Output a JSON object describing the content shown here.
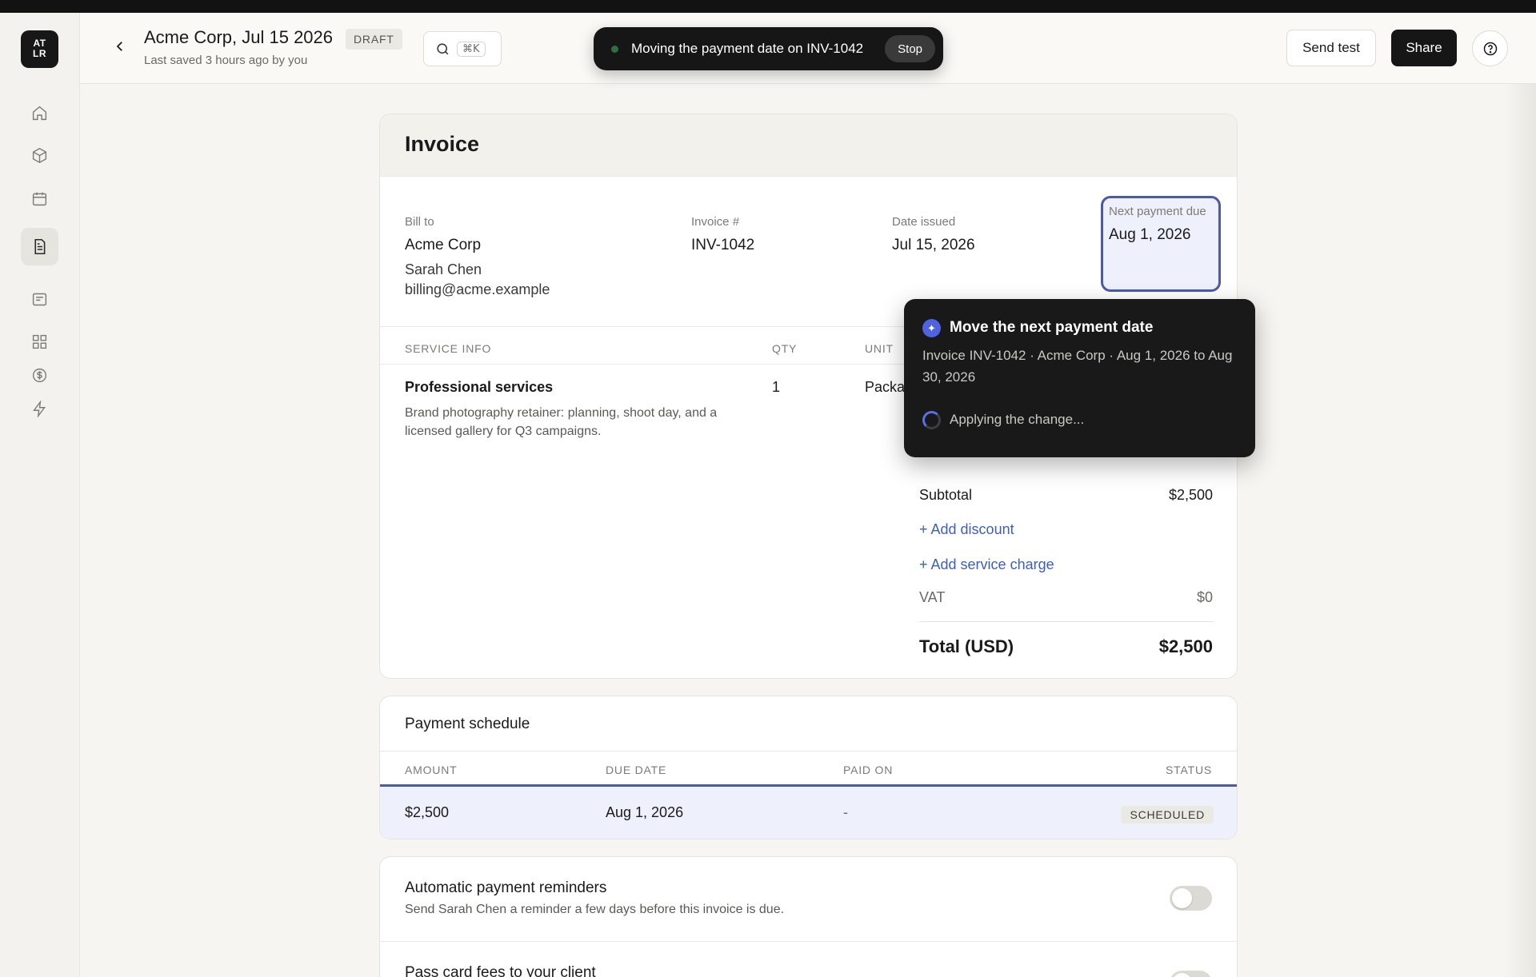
{
  "sidebar": {
    "logo_text": "AT LR",
    "items": [
      {
        "name": "home",
        "icon": "home-icon"
      },
      {
        "name": "packages",
        "icon": "box-icon"
      },
      {
        "name": "calendar",
        "icon": "calendar-icon"
      },
      {
        "name": "invoices",
        "icon": "document-icon",
        "active": true
      },
      {
        "name": "forms",
        "icon": "form-icon"
      },
      {
        "name": "apps",
        "icon": "grid-icon"
      },
      {
        "name": "payments",
        "icon": "dollar-icon"
      },
      {
        "name": "automations",
        "icon": "lightning-icon"
      }
    ]
  },
  "header": {
    "title": "Acme Corp, Jul 15 2026",
    "badge": "DRAFT",
    "saved": "Last saved 3 hours ago by you",
    "search_shortcut": "⌘K",
    "agent_status": "Moving the payment date on INV-1042",
    "stop_label": "Stop",
    "send_test_label": "Send test",
    "share_label": "Share"
  },
  "invoice": {
    "heading": "Invoice",
    "bill_to_label": "Bill to",
    "bill_to_company": "Acme Corp",
    "bill_to_contact": "Sarah Chen",
    "bill_to_email": "billing@acme.example",
    "invoice_no_label": "Invoice #",
    "invoice_no": "INV-1042",
    "date_issued_label": "Date issued",
    "date_issued": "Jul 15, 2026",
    "next_due_label": "Next payment due",
    "next_due": "Aug 1, 2026",
    "columns": {
      "service": "SERVICE INFO",
      "qty": "QTY",
      "unit": "UNIT"
    },
    "line_item": {
      "title": "Professional services",
      "description": "Brand photography retainer: planning, shoot day, and a licensed gallery for Q3 campaigns.",
      "qty": "1",
      "unit": "Packa"
    },
    "subtotal_label": "Subtotal",
    "subtotal": "$2,500",
    "add_discount": "+ Add discount",
    "add_service_charge": "+ Add service charge",
    "vat_label": "VAT",
    "vat": "$0",
    "total_label": "Total (USD)",
    "total": "$2,500"
  },
  "tooltip": {
    "title": "Move the next payment date",
    "body": "Invoice INV-1042 · Acme Corp · Aug 1, 2026 to Aug 30, 2026",
    "status": "Applying the change...",
    "icon": "sparkle-icon"
  },
  "schedule": {
    "title": "Payment schedule",
    "columns": {
      "amount": "AMOUNT",
      "due_date": "DUE DATE",
      "paid_on": "PAID ON",
      "status": "STATUS"
    },
    "row": {
      "amount": "$2,500",
      "due_date": "Aug 1, 2026",
      "paid_on": "-",
      "status": "SCHEDULED"
    }
  },
  "reminders": {
    "title": "Automatic payment reminders",
    "desc": "Send Sarah Chen a reminder a few days before this invoice is due.",
    "card_fees_title": "Pass card fees to your client"
  }
}
